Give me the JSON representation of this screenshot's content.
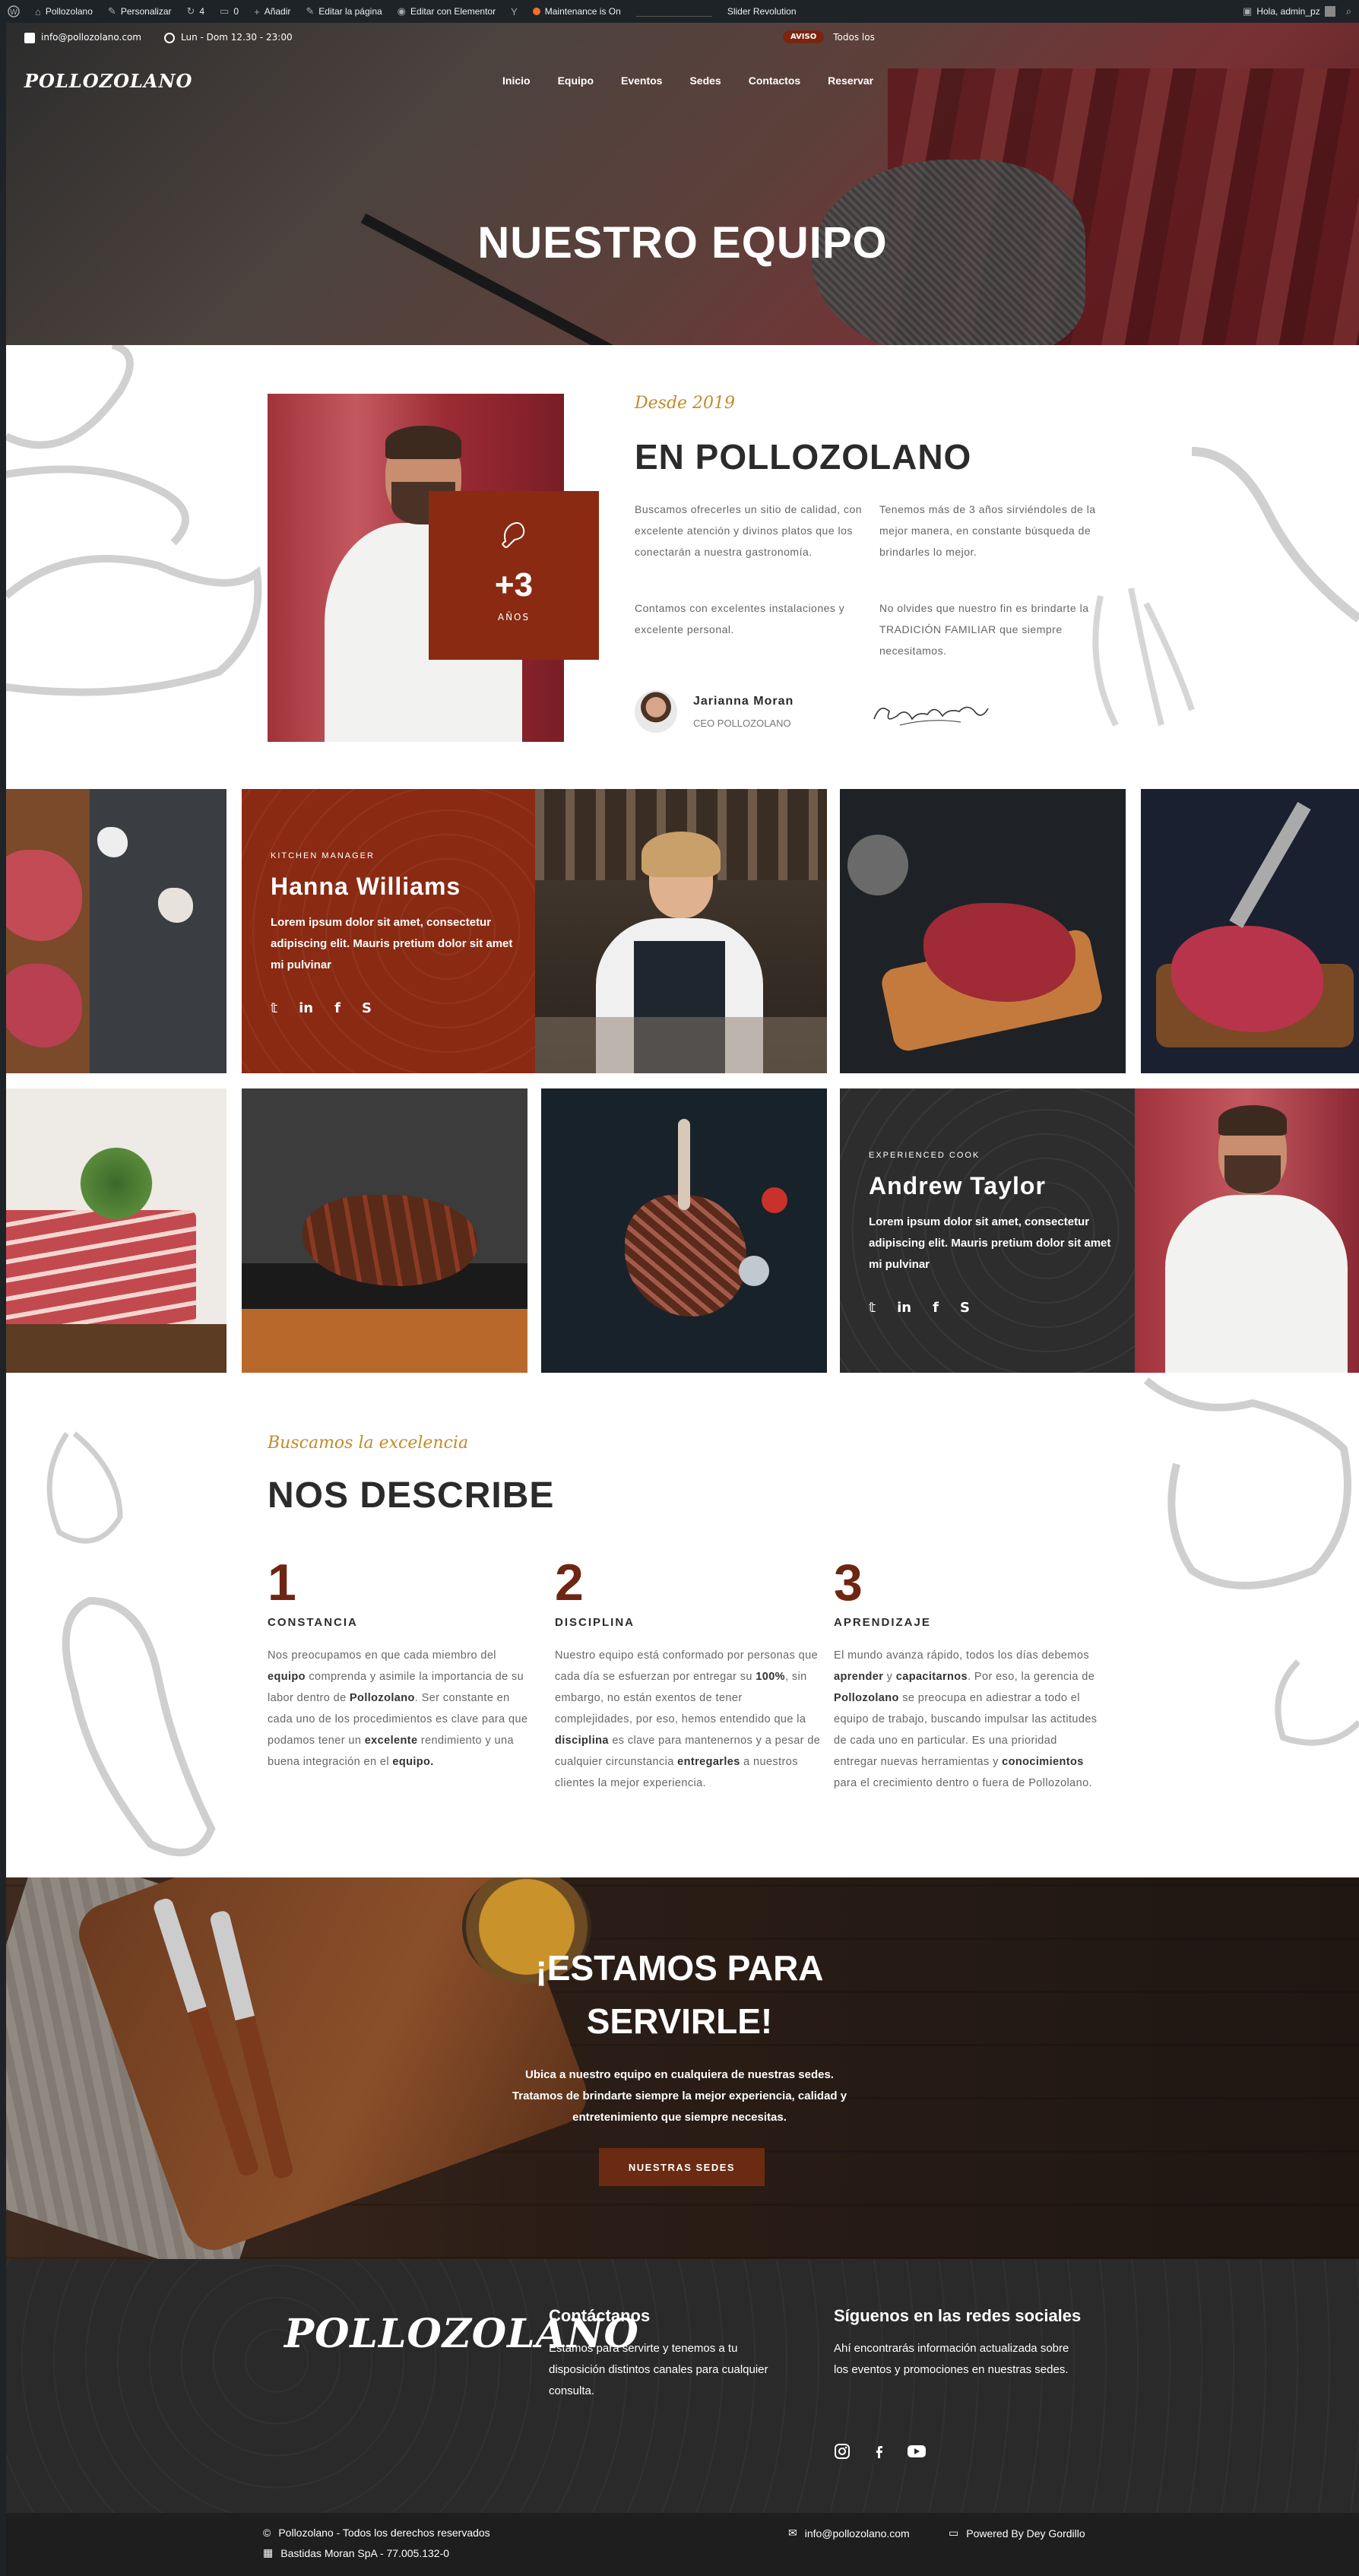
{
  "admin_bar": {
    "site_name": "Pollozolano",
    "customize": "Personalizar",
    "updates": "4",
    "comments": "0",
    "add_new": "Añadir",
    "edit_page": "Editar la página",
    "edit_elementor": "Editar con Elementor",
    "maintenance": "Maintenance is On",
    "slider": "Slider Revolution",
    "greeting": "Hola, admin_pz"
  },
  "top_info": {
    "email": "info@pollozolano.com",
    "hours": "Lun - Dom 12.30 - 23:00",
    "notice_badge": "AVISO",
    "notice_text": "Todos los"
  },
  "header": {
    "logo": "POLLOZOLANO",
    "nav": [
      "Inicio",
      "Equipo",
      "Eventos",
      "Sedes",
      "Contactos",
      "Reservar"
    ],
    "title": "NUESTRO EQUIPO"
  },
  "about": {
    "since": "Desde 2019",
    "title": "EN POLLOZOLANO",
    "years_number": "+3",
    "years_label": "AÑOS",
    "para1": "Buscamos ofrecerles un sitio de calidad, con excelente atención y divinos platos que los conectarán a nuestra gastronomía.",
    "para2": "Contamos con excelentes instalaciones y excelente personal.",
    "para3": "Tenemos más de 3 años sirviéndoles de la mejor manera, en constante búsqueda de brindarles lo mejor.",
    "para4": "No olvides que nuestro fin es brindarte la TRADICIÓN FAMILIAR que siempre necesitamos.",
    "ceo_name": "Jarianna Moran",
    "ceo_role": "CEO POLLOZOLANO"
  },
  "team": {
    "member1": {
      "role": "KITCHEN MANAGER",
      "name": "Hanna Williams",
      "desc": "Lorem ipsum dolor sit amet, consectetur adipiscing elit. Mauris pretium dolor sit amet mi pulvinar"
    },
    "member2": {
      "role": "EXPERIENCED COOK",
      "name": "Andrew Taylor",
      "desc": "Lorem ipsum dolor sit amet, consectetur adipiscing elit. Mauris pretium dolor sit amet mi pulvinar"
    },
    "social_icons": [
      "twitter-icon",
      "linkedin-icon",
      "facebook-icon",
      "skype-icon"
    ]
  },
  "describe": {
    "subtitle": "Buscamos la excelencia",
    "title": "NOS DESCRIBE",
    "columns": [
      {
        "num": "1",
        "title": "CONSTANCIA"
      },
      {
        "num": "2",
        "title": "DISCIPLINA"
      },
      {
        "num": "3",
        "title": "APRENDIZAJE"
      }
    ]
  },
  "cta": {
    "title_line1": "¡ESTAMOS PARA",
    "title_line2": "SERVIRLE!",
    "text_line1": "Ubica a nuestro equipo en cualquiera de nuestras sedes.",
    "text_line2": "Tratamos de brindarte siempre la mejor experiencia, calidad y",
    "text_line3": "entretenimiento que siempre necesitas.",
    "button": "NUESTRAS SEDES"
  },
  "footer": {
    "logo": "POLLOZOLANO",
    "contact_title": "Contáctanos",
    "contact_text": "Estamos para servirte y tenemos a tu disposición distintos canales para cualquier consulta.",
    "social_title": "Síguenos en las redes sociales",
    "social_text": "Ahí encontrarás información actualizada sobre los eventos y promociones en nuestras sedes.",
    "copyright": "Pollozolano - Todos los derechos reservados",
    "company": "Bastidas Moran SpA - 77.005.132-0",
    "email": "info@pollozolano.com",
    "powered": "Powered By Dey Gordillo"
  },
  "colors": {
    "accent_red": "#8a2a12",
    "gold": "#c38a2d",
    "dark": "#2d2d2d"
  }
}
